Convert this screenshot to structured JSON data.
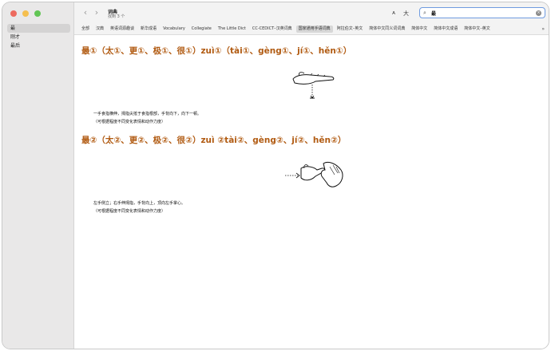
{
  "sidebar": {
    "items": [
      {
        "label": "最"
      },
      {
        "label": "刚才"
      },
      {
        "label": "最后"
      }
    ]
  },
  "toolbar": {
    "title": "词典",
    "subtitle": "找到 3 个",
    "back_icon": "chevron-left-icon",
    "forward_icon": "chevron-right-icon",
    "font_small_label": "ᴀ",
    "font_large_label": "大",
    "search_value": "最"
  },
  "tabs": [
    {
      "label": "全部"
    },
    {
      "label": "汉典"
    },
    {
      "label": "英语词源趣谈"
    },
    {
      "label": "新华成语"
    },
    {
      "label": "Vocabulary"
    },
    {
      "label": "Collegiate"
    },
    {
      "label": "The Little Dict"
    },
    {
      "label": "CC-CEDICT–汉英词典"
    },
    {
      "label": "国家通用手语词典",
      "selected": true
    },
    {
      "label": "阿拉伯文–英文"
    },
    {
      "label": "简体中文同义词词典"
    },
    {
      "label": "简体中文"
    },
    {
      "label": "简体中文成语"
    },
    {
      "label": "简体中文–英文"
    }
  ],
  "entries": [
    {
      "title": "最①（太①、更①、极①、很①）zuì①（tài①、gèng①、jí①、hěn①）",
      "line1": "一手食指横伸，拇指尖抵于食指根部，手背向下，向下一顿。",
      "line2": "（可根据程度不同变化表情和动作力度）"
    },
    {
      "title": "最②（太②、更②、极②、很②）zuì ②tài②、gèng②、jí②、hěn②）",
      "line1": "左手侧立；右手伸拇指，手背向上，顶向左手掌心。",
      "line2": "（可根据程度不同变化表情和动作力度）"
    }
  ],
  "colors": {
    "entry_title": "#b15b12",
    "search_focus": "#6f9be0",
    "sidebar_bg": "#e9e8e8"
  }
}
